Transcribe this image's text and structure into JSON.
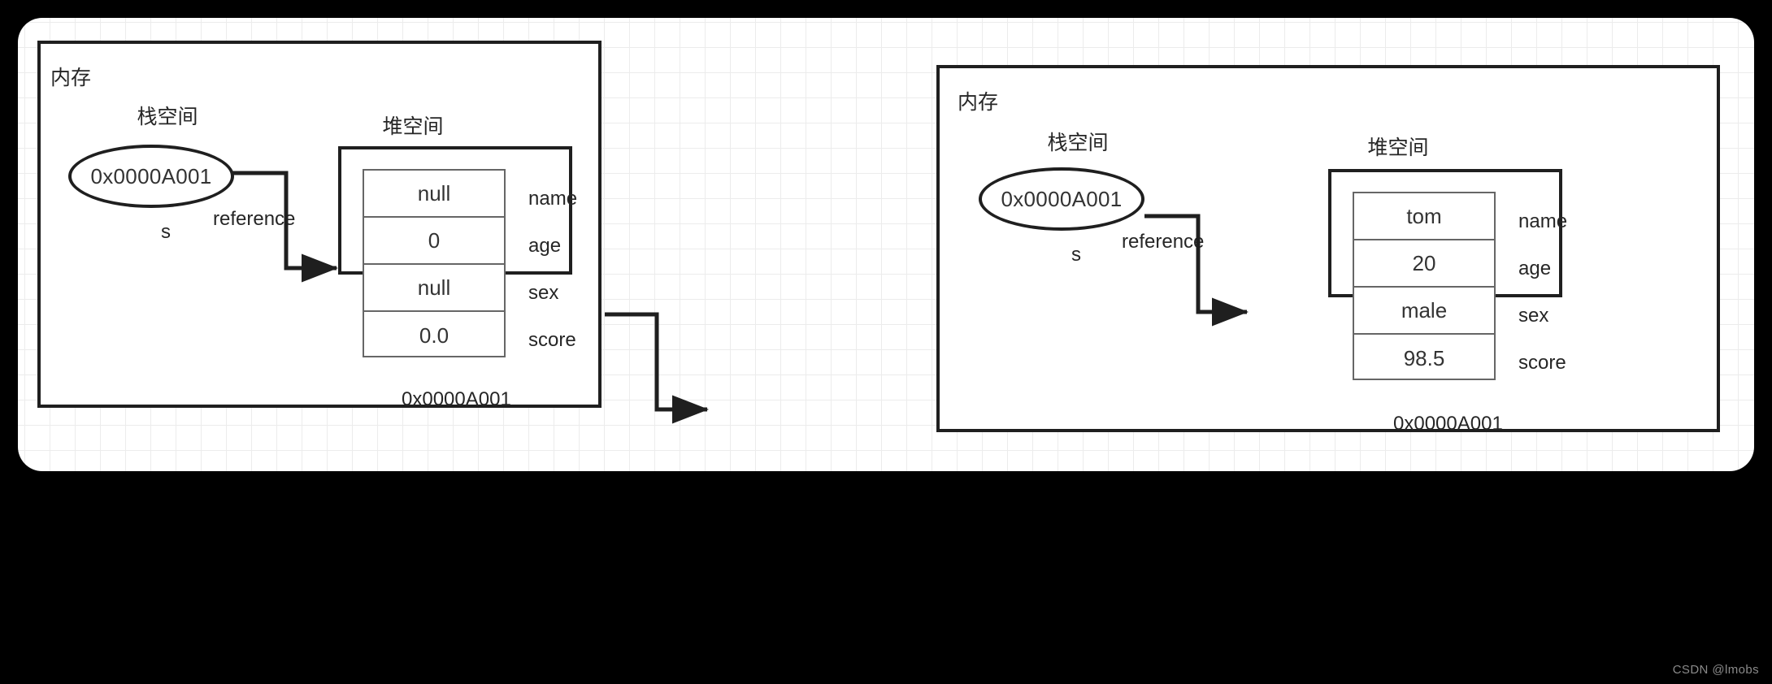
{
  "watermark": "CSDN @lmobs",
  "colors": {
    "page_background": "#000000",
    "canvas_background": "#ffffff",
    "grid_line": "#ececec",
    "stroke": "#1f1f1f",
    "table_stroke": "#666666",
    "text": "#262626",
    "watermark": "#8a8a8a"
  },
  "panels": [
    {
      "id": "before",
      "memory_title": "内存",
      "stack_title": "栈空间",
      "heap_title": "堆空间",
      "stack_ref_value": "0x0000A001",
      "stack_var_label": "s",
      "reference_label": "reference",
      "heap_address": "0x0000A001",
      "fields": [
        {
          "value": "null",
          "name": "name"
        },
        {
          "value": "0",
          "name": "age"
        },
        {
          "value": "null",
          "name": "sex"
        },
        {
          "value": "0.0",
          "name": "score"
        }
      ]
    },
    {
      "id": "after",
      "memory_title": "内存",
      "stack_title": "栈空间",
      "heap_title": "堆空间",
      "stack_ref_value": "0x0000A001",
      "stack_var_label": "s",
      "reference_label": "reference",
      "heap_address": "0x0000A001",
      "fields": [
        {
          "value": "tom",
          "name": "name"
        },
        {
          "value": "20",
          "name": "age"
        },
        {
          "value": "male",
          "name": "sex"
        },
        {
          "value": "98.5",
          "name": "score"
        }
      ]
    }
  ]
}
